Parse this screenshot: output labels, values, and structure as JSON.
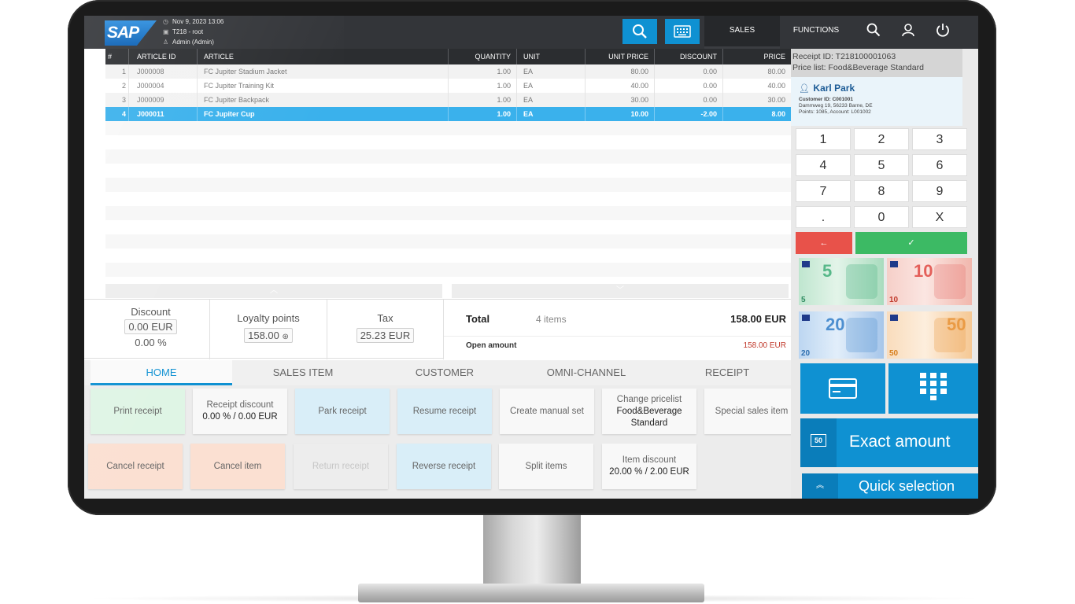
{
  "header": {
    "brand": "SAP",
    "datetime": "Nov 9, 2023 13:06",
    "terminal": "T218 - root",
    "user": "Admin (Admin)",
    "tab_sales": "SALES",
    "tab_functions": "FUNCTIONS"
  },
  "table": {
    "columns": [
      "#",
      "ARTICLE ID",
      "ARTICLE",
      "QUANTITY",
      "UNIT",
      "UNIT PRICE",
      "DISCOUNT",
      "PRICE"
    ],
    "rows": [
      {
        "n": "1",
        "id": "J000008",
        "article": "FC Jupiter Stadium Jacket",
        "qty": "1.00",
        "unit": "EA",
        "unit_price": "80.00",
        "discount": "0.00",
        "price": "80.00"
      },
      {
        "n": "2",
        "id": "J000004",
        "article": "FC Jupiter Training Kit",
        "qty": "1.00",
        "unit": "EA",
        "unit_price": "40.00",
        "discount": "0.00",
        "price": "40.00"
      },
      {
        "n": "3",
        "id": "J000009",
        "article": "FC Jupiter Backpack",
        "qty": "1.00",
        "unit": "EA",
        "unit_price": "30.00",
        "discount": "0.00",
        "price": "30.00"
      },
      {
        "n": "4",
        "id": "J000011",
        "article": "FC Jupiter Cup",
        "qty": "1.00",
        "unit": "EA",
        "unit_price": "10.00",
        "discount": "-2.00",
        "price": "8.00"
      }
    ]
  },
  "summary": {
    "discount_label": "Discount",
    "discount_value": "0.00 EUR",
    "discount_pct": "0.00 %",
    "loyalty_label": "Loyalty points",
    "loyalty_value": "158.00",
    "tax_label": "Tax",
    "tax_value": "25.23 EUR",
    "total_label": "Total",
    "items": "4 items",
    "total_value": "158.00 EUR",
    "open_label": "Open amount",
    "open_value": "158.00 EUR"
  },
  "tabs": [
    "HOME",
    "SALES ITEM",
    "CUSTOMER",
    "OMNI-CHANNEL",
    "RECEIPT"
  ],
  "actions": {
    "print_receipt": "Print receipt",
    "receipt_discount": "Receipt discount",
    "receipt_discount_value": "0.00 % / 0.00 EUR",
    "park_receipt": "Park receipt",
    "resume_receipt": "Resume receipt",
    "create_manual_set": "Create manual set",
    "change_pricelist": "Change pricelist",
    "change_pricelist_value": "Food&Beverage Standard",
    "special_sales_item": "Special sales item",
    "cancel_receipt": "Cancel receipt",
    "cancel_item": "Cancel item",
    "return_receipt": "Return receipt",
    "reverse_receipt": "Reverse receipt",
    "split_items": "Split items",
    "item_discount": "Item discount",
    "item_discount_value": "20.00 % / 2.00 EUR"
  },
  "receipt": {
    "id_line": "Receipt ID: T218100001063",
    "pricelist_line": "Price list: Food&Beverage Standard"
  },
  "customer": {
    "name": "Karl Park",
    "id_line": "Customer ID: C001001",
    "address": "Dammweg 19, 56233 Barne, DE",
    "points_line": "Points: 1085, Account: L001002"
  },
  "keypad": [
    "1",
    "2",
    "3",
    "4",
    "5",
    "6",
    "7",
    "8",
    "9",
    ".",
    "0",
    "X"
  ],
  "banknotes": [
    {
      "value": "5",
      "color": "#57b889"
    },
    {
      "value": "10",
      "color": "#e4605a"
    },
    {
      "value": "20",
      "color": "#4d8fd0"
    },
    {
      "value": "50",
      "color": "#ea9b45"
    }
  ],
  "payment": {
    "exact_amount": "Exact amount",
    "exact_icon_label": "50",
    "quick_selection": "Quick selection"
  },
  "colors": {
    "accent": "#0f91d2",
    "selected_row": "#3ab1ec",
    "cancel_red": "#e8524a",
    "confirm_green": "#3cba64",
    "open_amount": "#c0392b"
  }
}
